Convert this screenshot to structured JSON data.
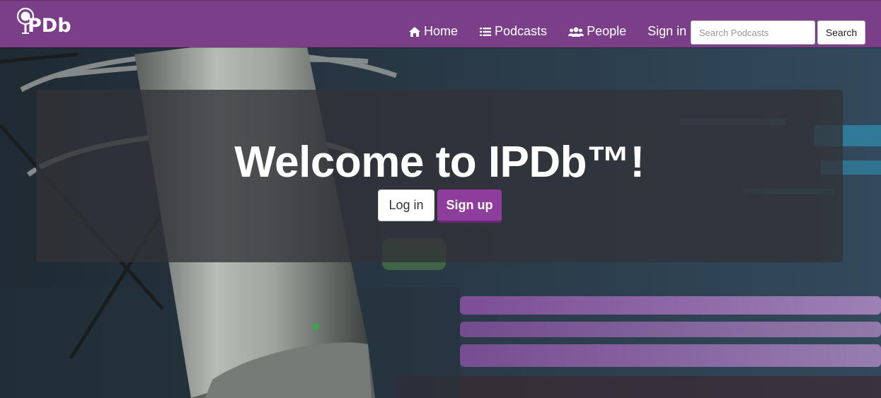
{
  "brand": {
    "logo_text": "IPDb"
  },
  "nav": {
    "items": [
      {
        "label": "Home",
        "icon": "home-icon"
      },
      {
        "label": "Podcasts",
        "icon": "list-icon"
      },
      {
        "label": "People",
        "icon": "users-icon"
      },
      {
        "label": "Sign in",
        "icon": ""
      }
    ]
  },
  "search": {
    "placeholder": "Search Podcasts",
    "value": "",
    "button_label": "Search"
  },
  "hero": {
    "title": "Welcome to IPDb™!",
    "login_label": "Log in",
    "signup_label": "Sign up",
    "background": "studio-microphone-photo"
  },
  "colors": {
    "navbar": "#7b3f8a",
    "signup_button": "#8e3d9c",
    "jumbotron_overlay": "rgba(50,50,55,0.78)"
  }
}
